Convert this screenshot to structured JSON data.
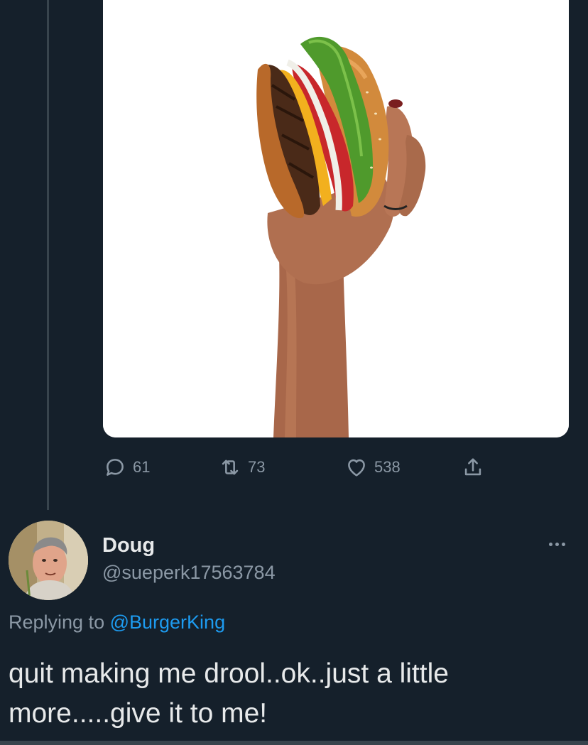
{
  "media": {
    "icon": "burger-in-hand-photo"
  },
  "actions": {
    "reply": {
      "icon": "reply-bubble-icon",
      "count": "61"
    },
    "retweet": {
      "icon": "retweet-icon",
      "count": "73"
    },
    "like": {
      "icon": "heart-icon",
      "count": "538"
    },
    "share": {
      "icon": "share-icon"
    }
  },
  "reply_tweet": {
    "display_name": "Doug",
    "handle": "@sueperk17563784",
    "replying_prefix": "Replying to ",
    "replying_to": "@BurgerKing",
    "text": "quit making me drool..ok..just a little\nmore.....give it to me!",
    "more_icon": "more-dots-icon"
  },
  "colors": {
    "background": "#15202b",
    "secondary_text": "#8b98a5",
    "primary_text": "#e7e9ea",
    "link": "#1d9bf0"
  }
}
